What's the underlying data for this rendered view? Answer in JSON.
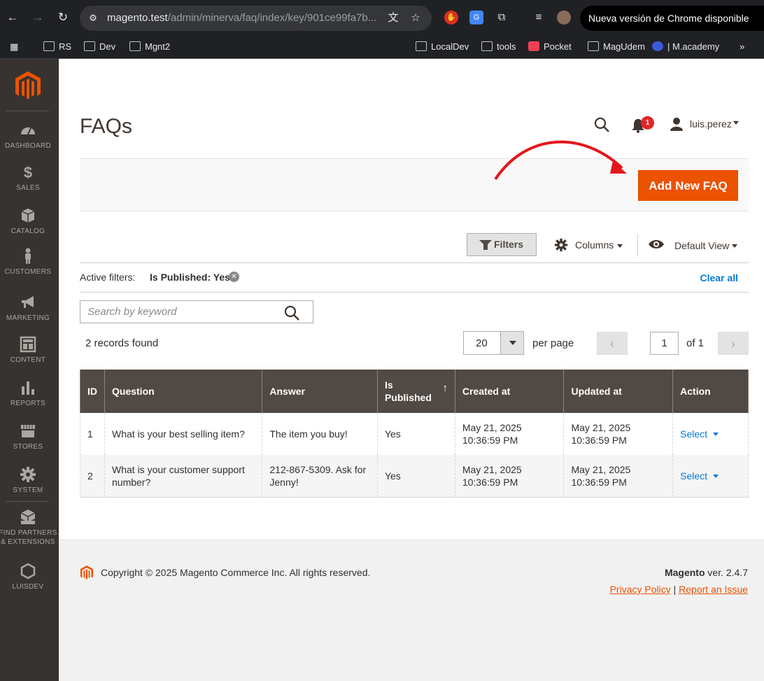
{
  "browser": {
    "url_host": "magento.test",
    "url_path": "/admin/minerva/faq/index/key/901ce99fa7b...",
    "update_label": "Nueva versión de Chrome disponible",
    "bookmarks": [
      "RS",
      "Dev",
      "Mgnt2",
      "LocalDev",
      "tools",
      "Pocket",
      "MagUdem",
      "| M.academy"
    ]
  },
  "sidebar": {
    "items": [
      {
        "label": "DASHBOARD",
        "icon": "dashboard-icon"
      },
      {
        "label": "SALES",
        "icon": "dollar-icon"
      },
      {
        "label": "CATALOG",
        "icon": "box-icon"
      },
      {
        "label": "CUSTOMERS",
        "icon": "person-icon"
      },
      {
        "label": "MARKETING",
        "icon": "megaphone-icon"
      },
      {
        "label": "CONTENT",
        "icon": "content-icon"
      },
      {
        "label": "REPORTS",
        "icon": "bar-chart-icon"
      },
      {
        "label": "STORES",
        "icon": "store-icon"
      },
      {
        "label": "SYSTEM",
        "icon": "gear-icon"
      },
      {
        "label": "FIND PARTNERS & EXTENSIONS",
        "icon": "boxes-icon"
      },
      {
        "label": "LUISDEV",
        "icon": "hexagon-icon"
      }
    ]
  },
  "header": {
    "title": "FAQs",
    "notifications": "1",
    "username": "luis.perez"
  },
  "actions": {
    "add_new": "Add New FAQ"
  },
  "toolbar": {
    "filters": "Filters",
    "columns": "Columns",
    "view": "Default View",
    "active_filters_label": "Active filters:",
    "active_filter_value": "Is Published: Yes",
    "clear_all": "Clear all",
    "search_placeholder": "Search by keyword",
    "records_found": "2 records found",
    "per_page_value": "20",
    "per_page_label": "per page",
    "page": "1",
    "of_pages": "of 1"
  },
  "grid": {
    "columns": [
      "ID",
      "Question",
      "Answer",
      "Is Published",
      "Created at",
      "Updated at",
      "Action"
    ],
    "rows": [
      {
        "id": "1",
        "question": "What is your best selling item?",
        "answer": "The item you buy!",
        "published": "Yes",
        "created": "May 21, 2025 10:36:59 PM",
        "updated": "May 21, 2025 10:36:59 PM",
        "action": "Select"
      },
      {
        "id": "2",
        "question": "What is your customer support number?",
        "answer": "212-867-5309. Ask for Jenny!",
        "published": "Yes",
        "created": "May 21, 2025 10:36:59 PM",
        "updated": "May 21, 2025 10:36:59 PM",
        "action": "Select"
      }
    ]
  },
  "footer": {
    "copyright": "Copyright © 2025 Magento Commerce Inc. All rights reserved.",
    "brand": "Magento",
    "version": "ver. 2.4.7",
    "privacy": "Privacy Policy",
    "separator": "|",
    "report": "Report an Issue"
  },
  "colors": {
    "accent": "#eb5202",
    "sidebar": "#373330",
    "grid_header": "#514943",
    "link": "#007bdb"
  }
}
